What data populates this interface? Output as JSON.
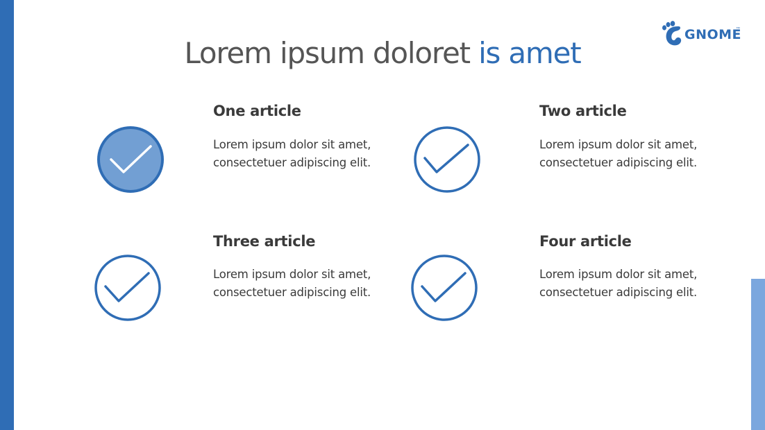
{
  "slide": {
    "title_main": "Lorem ipsum doloret",
    "title_accent": "is amet"
  },
  "logo": {
    "text": "GNOME",
    "trademark": "™"
  },
  "articles": [
    {
      "heading": "One article",
      "line1": "Lorem ipsum dolor sit amet,",
      "line2": "consectetuer adipiscing elit."
    },
    {
      "heading": "Two article",
      "line1": "Lorem ipsum dolor sit amet,",
      "line2": "consectetuer adipiscing elit."
    },
    {
      "heading": "Three article",
      "line1": "Lorem ipsum dolor sit amet,",
      "line2": "consectetuer adipiscing elit."
    },
    {
      "heading": "Four article",
      "line1": "Lorem ipsum dolor sit amet,",
      "line2": "consectetuer adipiscing elit."
    }
  ],
  "colors": {
    "primary": "#2f6db5",
    "accent_light": "#7ba7de",
    "filled_check": "#729fd3",
    "text": "#3a3a3a"
  },
  "icons": {
    "check": "check-circle-icon",
    "logo": "gnome-foot-icon"
  }
}
